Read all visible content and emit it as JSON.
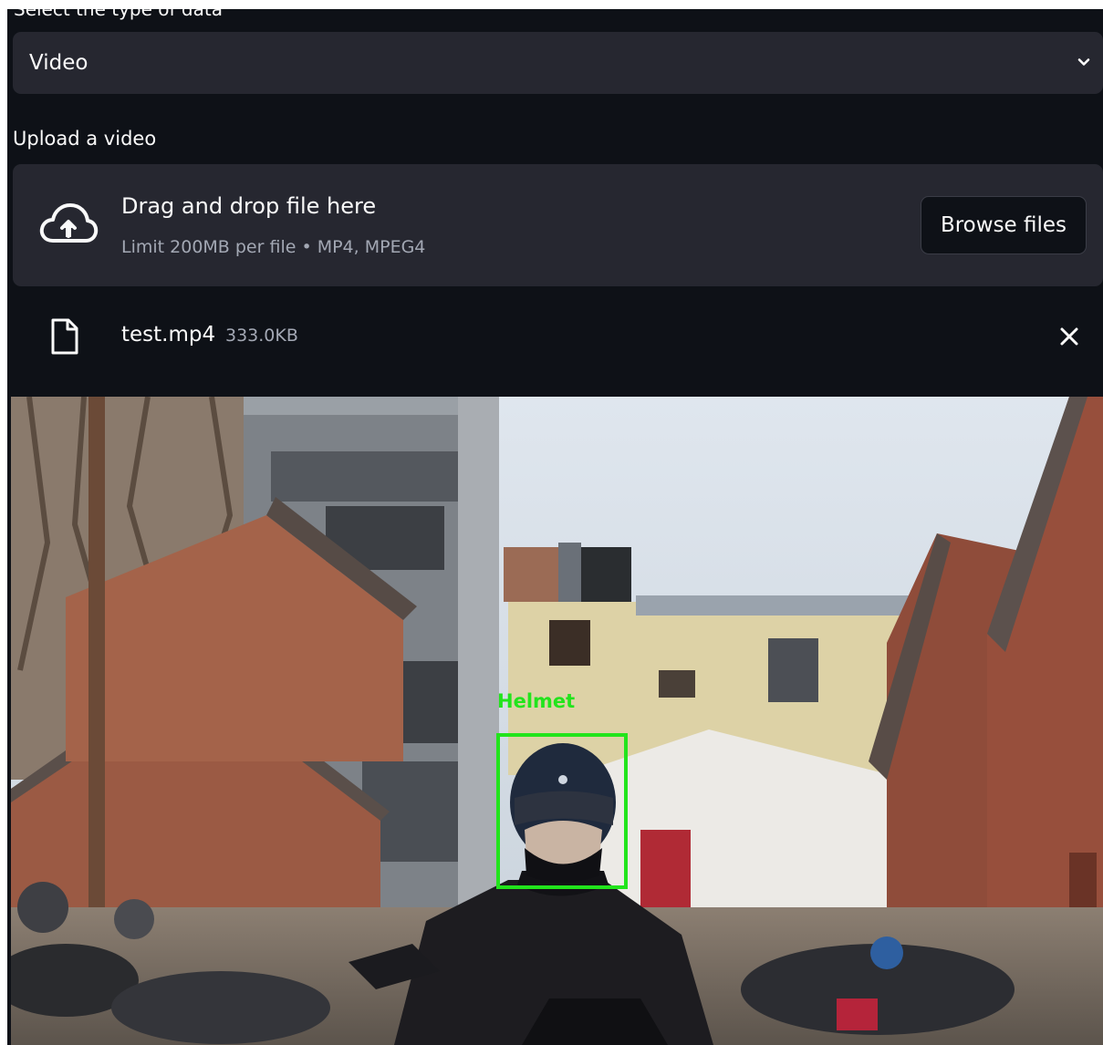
{
  "select": {
    "label": "Select the type of data",
    "value": "Video"
  },
  "uploader": {
    "label": "Upload a video",
    "drop_title": "Drag and drop file here",
    "drop_limit": "Limit 200MB per file • MP4, MPEG4",
    "browse_label": "Browse files"
  },
  "file": {
    "name": "test.mp4",
    "size": "333.0KB"
  },
  "video": {
    "detection_label": "Helmet",
    "detection_color": "#22e41c"
  },
  "colors": {
    "background": "#0e1117",
    "widget": "#262730",
    "muted_text": "#a3a8b4"
  },
  "icons": {
    "dropzone": "cloud-upload-icon",
    "file": "file-icon",
    "remove": "close-icon",
    "select": "chevron-down-icon"
  }
}
